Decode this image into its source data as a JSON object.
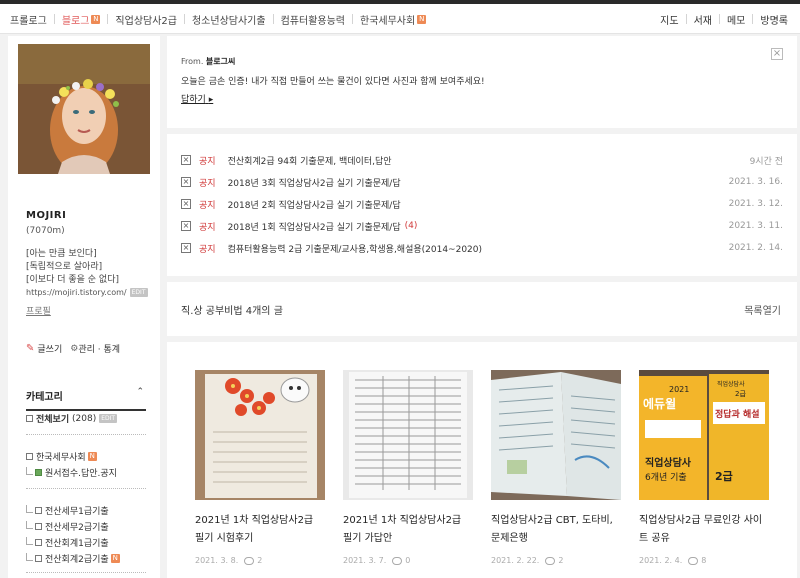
{
  "topnav": {
    "items": [
      {
        "label": "프롤로그",
        "badge": ""
      },
      {
        "label": "블로그",
        "badge": "N"
      },
      {
        "label": "직업상담사2급",
        "badge": ""
      },
      {
        "label": "청소년상담사기출",
        "badge": ""
      },
      {
        "label": "컴퓨터활용능력",
        "badge": ""
      },
      {
        "label": "한국세무사회",
        "badge": "N"
      }
    ],
    "right": [
      "지도",
      "서재",
      "메모",
      "방명록"
    ]
  },
  "sidebar": {
    "blog_name": "MOJIRI",
    "visits": "(7070m)",
    "desc": [
      "[아는 만큼 보인다]",
      "[독립적으로 살아라]",
      "[이보다 더 좋을 순 없다]"
    ],
    "url": "https://mojiri.tistory.com/",
    "edit_badge": "EDIT",
    "profile_link": "프로필",
    "write": "글쓰기",
    "manage": "관리 · 통계",
    "category_title": "카테고리",
    "categories": [
      {
        "label": "전체보기",
        "count": "(208)",
        "badge": "EDIT"
      },
      {
        "label": "한국세무사회",
        "badge": "N"
      },
      {
        "label": "원서접수.답안.공지"
      },
      {
        "label": "전산세무1급기출"
      },
      {
        "label": "전산세무2급기출"
      },
      {
        "label": "전산회계1급기출"
      },
      {
        "label": "전산회계2급기출",
        "badge": "N"
      }
    ]
  },
  "guestbook": {
    "from_prefix": "From.",
    "from_name": "블로그씨",
    "message": "오늘은 금손 인증! 내가 직접 만들어 쓰는 물건이 있다면 사진과 함께 보여주세요!",
    "reply": "답하기"
  },
  "notices": [
    {
      "tag": "공지",
      "title": "전산회계2급 94회 기출문제, 백데이터,답안",
      "count": "",
      "date": "9시간 전"
    },
    {
      "tag": "공지",
      "title": "2018년 3회 직업상담사2급 실기 기출문제/답",
      "count": "",
      "date": "2021. 3. 16."
    },
    {
      "tag": "공지",
      "title": "2018년 2회 직업상담사2급 실기 기출문제/답",
      "count": "",
      "date": "2021. 3. 12."
    },
    {
      "tag": "공지",
      "title": "2018년 1회 직업상담사2급 실기 기출문제/답",
      "count": "(4)",
      "date": "2021. 3. 11."
    },
    {
      "tag": "공지",
      "title": "컴퓨터활용능력 2급 기출문제/교사용,학생용,해설용(2014~2020)",
      "count": "",
      "date": "2021. 2. 14."
    }
  ],
  "category_header": {
    "title": "직.상 공부비법",
    "count": "4개의 글",
    "list_link": "목록열기"
  },
  "posts": [
    {
      "title": "2021년 1차 직업상담사2급 필기 시험후기",
      "date": "2021. 3. 8.",
      "comments": "2"
    },
    {
      "title": "2021년 1차 직업상담사2급 필기 가답안",
      "date": "2021. 3. 7.",
      "comments": "0"
    },
    {
      "title": "직업상담사2급 CBT, 도타비, 문제은행",
      "date": "2021. 2. 22.",
      "comments": "2"
    },
    {
      "title": "직업상담사2급 무료인강 사이트 공유",
      "date": "2021. 2. 4.",
      "comments": "8"
    }
  ],
  "post_images": [
    {
      "text": []
    },
    {
      "text": []
    },
    {
      "text": []
    },
    {
      "text": [
        "2021",
        "에듀윌",
        "직업상담사",
        "2급",
        "정답과 해설",
        "직업상담사",
        "6개년 기출",
        "2급"
      ]
    }
  ],
  "colors": {
    "accent": "#e05a5a",
    "notice_tag": "#d03a3a",
    "badge": "#ee8a55"
  }
}
